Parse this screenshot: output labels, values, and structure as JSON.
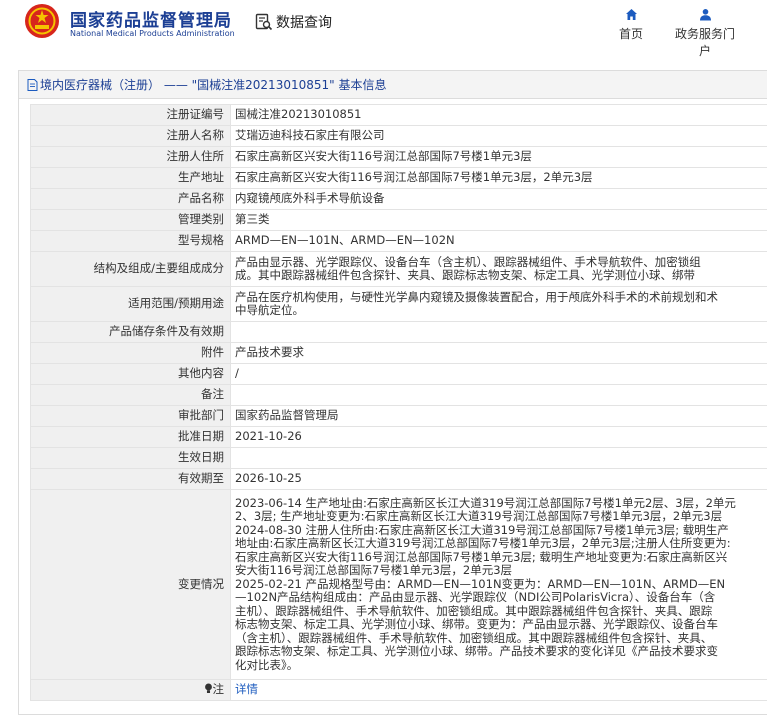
{
  "header": {
    "brand_cn": "国家药品监督管理局",
    "brand_en": "National Medical Products Administration",
    "query_label": "数据查询",
    "nav": {
      "home": "首页",
      "portal": "政务服务门户"
    }
  },
  "panel": {
    "title": "境内医疗器械（注册） —— \"国械注准20213010851\" 基本信息"
  },
  "rows": [
    {
      "label": "注册证编号",
      "value": "国械注准20213010851"
    },
    {
      "label": "注册人名称",
      "value": "艾瑞迈迪科技石家庄有限公司"
    },
    {
      "label": "注册人住所",
      "value": "石家庄高新区兴安大街116号润江总部国际7号楼1单元3层"
    },
    {
      "label": "生产地址",
      "value": "石家庄高新区兴安大街116号润江总部国际7号楼1单元3层，2单元3层"
    },
    {
      "label": "产品名称",
      "value": "内窥镜颅底外科手术导航设备"
    },
    {
      "label": "管理类别",
      "value": "第三类"
    },
    {
      "label": "型号规格",
      "value": "ARMD—EN—101N、ARMD—EN—102N"
    },
    {
      "label": "结构及组成/主要组成成分",
      "value": "产品由显示器、光学跟踪仪、设备台车（含主机）、跟踪器械组件、手术导航软件、加密锁组\n成。其中跟踪器械组件包含探针、夹具、跟踪标志物支架、标定工具、光学测位小球、绑带"
    },
    {
      "label": "适用范围/预期用途",
      "value": "产品在医疗机构使用，与硬性光学鼻内窥镜及摄像装置配合，用于颅底外科手术的术前规划和术\n中导航定位。"
    },
    {
      "label": "产品储存条件及有效期",
      "value": ""
    },
    {
      "label": "附件",
      "value": "产品技术要求"
    },
    {
      "label": "其他内容",
      "value": "/"
    },
    {
      "label": "备注",
      "value": ""
    },
    {
      "label": "审批部门",
      "value": "国家药品监督管理局"
    },
    {
      "label": "批准日期",
      "value": "2021-10-26"
    },
    {
      "label": "生效日期",
      "value": ""
    },
    {
      "label": "有效期至",
      "value": "2026-10-25"
    },
    {
      "label": "变更情况",
      "value": "2023-06-14 生产地址由:石家庄高新区长江大道319号润江总部国际7号楼1单元2层、3层，2单元\n2、3层; 生产地址变更为:石家庄高新区长江大道319号润江总部国际7号楼1单元3层，2单元3层\n2024-08-30 注册人住所由:石家庄高新区长江大道319号润江总部国际7号楼1单元3层; 载明生产\n地址由:石家庄高新区长江大道319号润江总部国际7号楼1单元3层，2单元3层;注册人住所变更为:\n石家庄高新区兴安大街116号润江总部国际7号楼1单元3层; 载明生产地址变更为:石家庄高新区兴\n安大街116号润江总部国际7号楼1单元3层，2单元3层\n2025-02-21 产品规格型号由：ARMD—EN—101N变更为：ARMD—EN—101N、ARMD—EN\n—102N产品结构组成由：产品由显示器、光学跟踪仪（NDI公司PolarisVicra）、设备台车（含\n主机）、跟踪器械组件、手术导航软件、加密锁组成。其中跟踪器械组件包含探针、夹具、跟踪\n标志物支架、标定工具、光学测位小球、绑带。变更为：产品由显示器、光学跟踪仪、设备台车\n（含主机）、跟踪器械组件、手术导航软件、加密锁组成。其中跟踪器械组件包含探针、夹具、\n跟踪标志物支架、标定工具、光学测位小球、绑带。产品技术要求的变化详见《产品技术要求变\n化对比表》。"
    },
    {
      "label": "注",
      "value": "详情"
    }
  ]
}
